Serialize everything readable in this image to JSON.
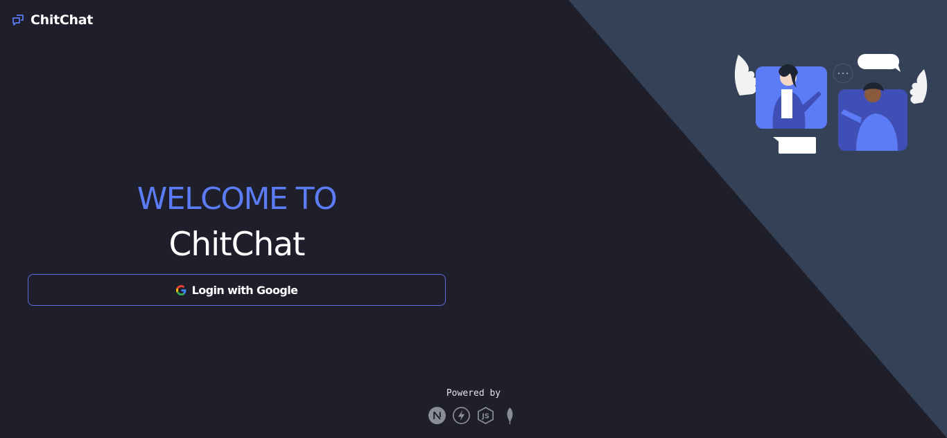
{
  "header": {
    "brand_name": "ChitChat",
    "brand_icon": "chat-bubbles-icon"
  },
  "hero": {
    "welcome": "WELCOME TO",
    "title": "ChitChat"
  },
  "login": {
    "label": "Login with Google",
    "icon": "google-icon"
  },
  "footer": {
    "powered_by": "Powered by",
    "tech": [
      "nextjs-icon",
      "socketio-icon",
      "nodejs-icon",
      "mongodb-icon"
    ]
  },
  "colors": {
    "background": "#1e1f2b",
    "diagonal_panel": "#344156",
    "accent": "#5b7cf5",
    "button_border": "#5b6de0",
    "text": "#ffffff"
  }
}
